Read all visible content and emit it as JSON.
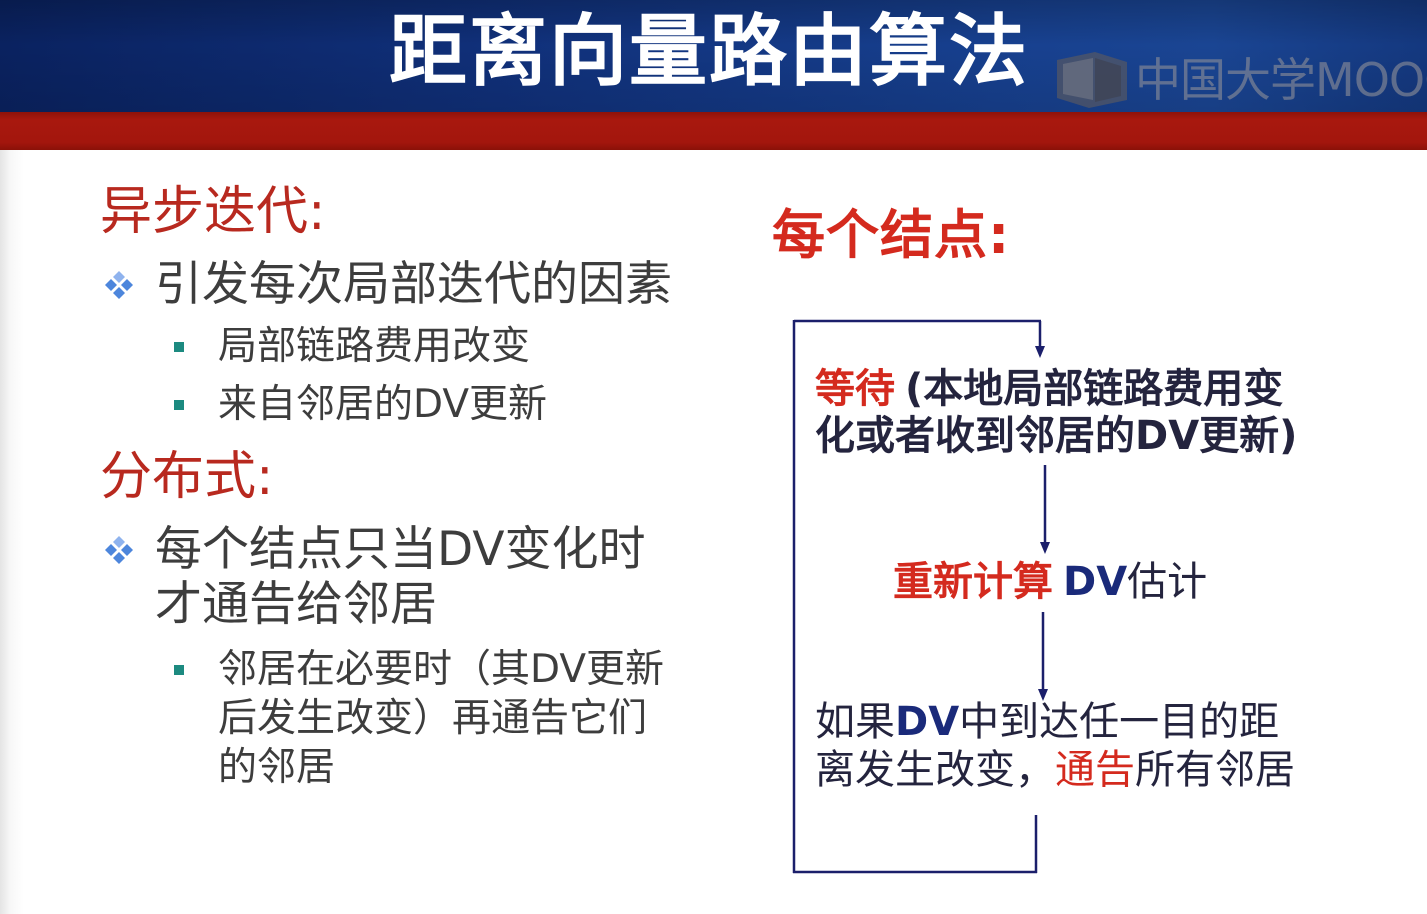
{
  "header": {
    "title": "距离向量路由算法",
    "watermark": "中国大学MOOC"
  },
  "left": {
    "async": {
      "heading": "异步迭代:",
      "bullet": "引发每次局部迭代的因素",
      "subitems": [
        "局部链路费用改变",
        "来自邻居的DV更新"
      ]
    },
    "distributed": {
      "heading": "分布式:",
      "bullet_lines": [
        "每个结点只当DV变化时",
        "才通告给邻居"
      ],
      "subitem_lines": [
        "邻居在必要时（其DV更新",
        "后发生改变）再通告它们",
        "的邻居"
      ]
    }
  },
  "right": {
    "heading": "每个结点:",
    "flow": {
      "wait": {
        "keyword": "等待",
        "line1_rest": "(本地局部链路费用变",
        "line2": "化或者收到邻居的DV更新)"
      },
      "recompute": {
        "keyword": "重新计算",
        "dv": "DV",
        "rest": "估计"
      },
      "notify": {
        "line1_pre": "如果",
        "line1_dv": "DV",
        "line1_rest": "中到达任一目的距",
        "line2_pre": "离发生改变，",
        "line2_keyword": "通告",
        "line2_rest": "所有邻居"
      }
    }
  },
  "icons": {
    "main_bullet": "diamond-bullet-icon",
    "sub_bullet": "square-bullet-icon",
    "watermark_logo": "mooc-logo-icon"
  },
  "colors": {
    "title_text": "#ffffff",
    "header_blue": "#17408f",
    "header_blue_dark": "#0a2260",
    "band_red": "#a8180e",
    "heading_red": "#b8291f",
    "flow_red": "#d42a1e",
    "body_text": "#3d3d3d",
    "flow_text": "#24243e",
    "dv_navy": "#1a2a7a",
    "bullet_blue": "#4d86dc",
    "bullet_teal": "#1c8a80",
    "flow_line": "#1b1f6b",
    "watermark_gray": "rgba(140,142,152,0.62)"
  }
}
